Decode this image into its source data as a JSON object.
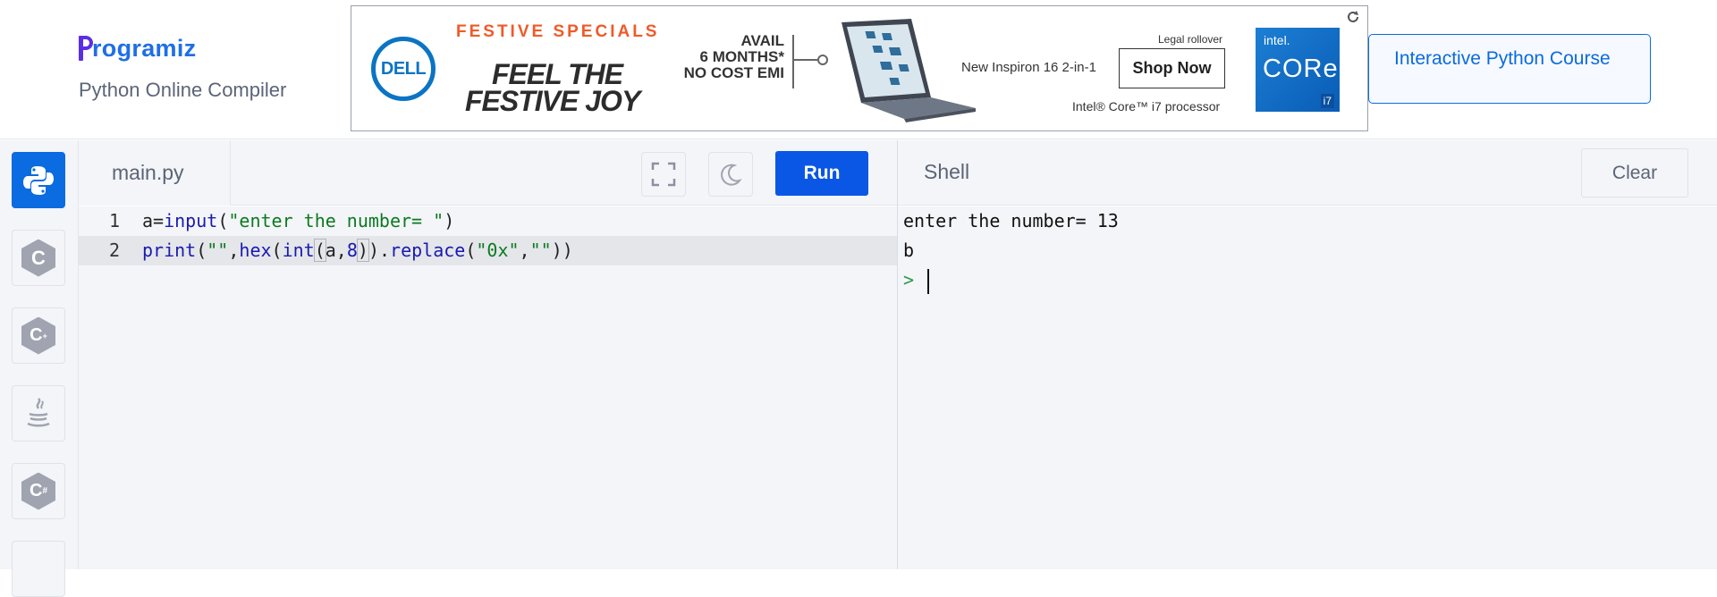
{
  "header": {
    "logo_text": "rogramiz",
    "logo_full": "Programiz",
    "subtitle": "Python Online Compiler",
    "course_button": "Interactive Python Course"
  },
  "ad": {
    "brand": "DELL",
    "headline": "FESTIVE SPECIALS",
    "tagline_1": "FEEL THE",
    "tagline_2": "FESTIVE JOY",
    "emi_1": "AVAIL",
    "emi_2": "6 MONTHS*",
    "emi_3": "NO COST EMI",
    "product": "New Inspiron 16 2-in-1",
    "legal": "Legal rollover",
    "cta": "Shop Now",
    "processor": "Intel® Core™ i7 processor",
    "intel_top": "intel.",
    "intel_core": "CORe",
    "intel_gen": "i7"
  },
  "sidebar": {
    "languages": [
      {
        "name": "Python",
        "icon": "python-icon",
        "active": true
      },
      {
        "name": "C",
        "icon": "c-icon",
        "active": false
      },
      {
        "name": "C++",
        "icon": "cpp-icon",
        "active": false
      },
      {
        "name": "Java",
        "icon": "java-icon",
        "active": false
      },
      {
        "name": "C#",
        "icon": "csharp-icon",
        "active": false
      }
    ]
  },
  "editor": {
    "file_name": "main.py",
    "run_label": "Run",
    "lines": [
      {
        "number": "1",
        "code": "a=input(\"enter the number= \")"
      },
      {
        "number": "2",
        "code": "print(\"\",hex(int(a,8)).replace(\"0x\",\"\"))"
      }
    ]
  },
  "shell": {
    "title": "Shell",
    "clear_label": "Clear",
    "output": [
      "enter the number= 13",
      "b"
    ],
    "prompt": ">"
  },
  "colors": {
    "accent": "#0b57e5",
    "brand_blue": "#1f6fe5",
    "brand_purple": "#5b2ee6",
    "ad_orange": "#f05a28",
    "string_green": "#0c7a1f",
    "keyword_blue": "#1a1ab0"
  }
}
